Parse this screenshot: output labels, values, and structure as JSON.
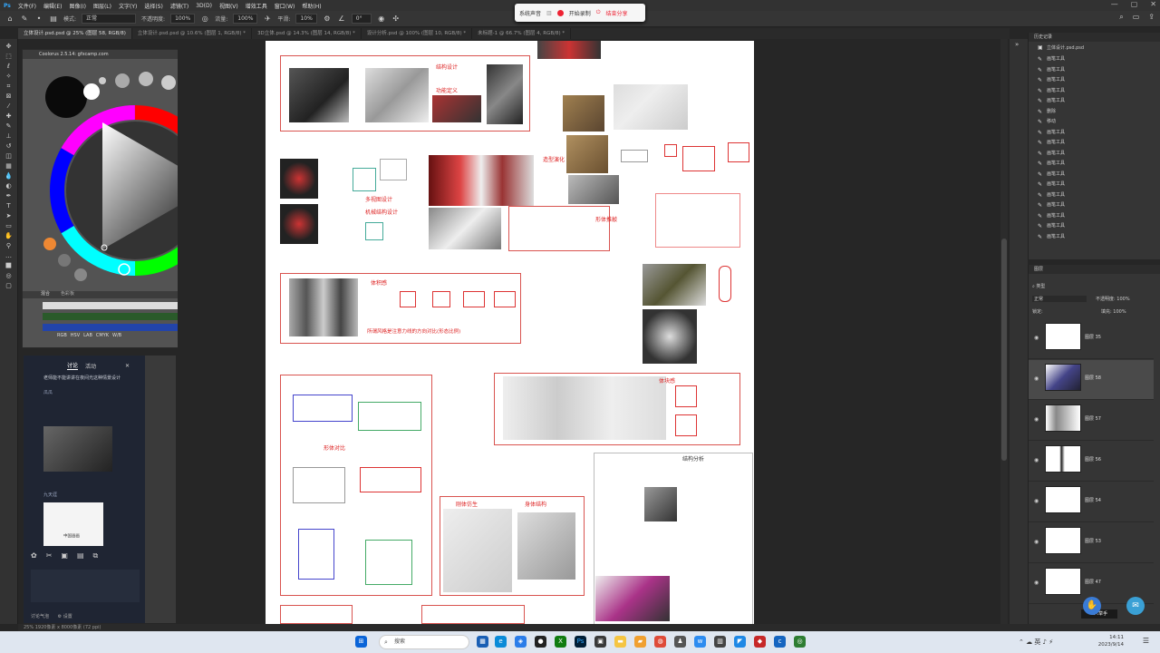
{
  "menubar": {
    "items": [
      "文件(F)",
      "编辑(E)",
      "图像(I)",
      "图层(L)",
      "文字(Y)",
      "选择(S)",
      "滤镜(T)",
      "3D(D)",
      "视图(V)",
      "增效工具",
      "窗口(W)",
      "帮助(H)"
    ]
  },
  "window_controls": {
    "minimize": "—",
    "maximize": "▢",
    "close": "✕"
  },
  "options": {
    "mode_label": "模式:",
    "mode_value": "正常",
    "opacity_label": "不透明度:",
    "opacity_value": "100%",
    "flow_label": "流量:",
    "flow_value": "100%",
    "smooth_label": "平滑:",
    "smooth_value": "10%",
    "angle_value": "0°"
  },
  "recorder": {
    "system_sound": "系统声音",
    "start": "开始录制",
    "end_share": "结束分享"
  },
  "tabs": [
    {
      "label": "立体设计.psd.psd @ 25% (图层 58, RGB/8)",
      "active": true
    },
    {
      "label": "立体设计.psd.psd @ 10.6% (图层 1, RGB/8) *",
      "active": false
    },
    {
      "label": "3D立体.psd @ 14.3% (图层 14, RGB/8) *",
      "active": false
    },
    {
      "label": "设计分析.psd @ 100% (图层 10, RGB/8) *",
      "active": false
    },
    {
      "label": "未标题-1 @ 66.7% (图层 4, RGB/8) *",
      "active": false
    }
  ],
  "coolorus": {
    "title": "Coolorus 2.5.14: gfxcamp.com",
    "tab_mix": "混合",
    "tab_swatch": "色彩板",
    "slider_values": [
      "2",
      "2",
      "-2"
    ],
    "modes": [
      "RGB",
      "HSV",
      "LAB",
      "CMYK",
      "W/B"
    ],
    "counter": "#0000"
  },
  "chat": {
    "tab_discuss": "讨论",
    "tab_activity": "活动",
    "message_text": "老师能不能讲讲在夜间光这种情景设计",
    "user1": "瓜瓜",
    "user2": "九天涯",
    "user2_image_caption": "中国画画",
    "bottom_text": "讨论气泡",
    "bottom_settings": "设置"
  },
  "page_notes": {
    "n1": "结构设计",
    "n2": "功能定义",
    "n3": "造型演化",
    "n4": "多视图设计",
    "n5": "机械结构设计",
    "n6": "形体推敲",
    "n7": "所谓风格是注意力线的方向对比(形态比例)",
    "n8": "体积感",
    "n9": "形体对比",
    "n10": "体块感",
    "n11": "结构分析",
    "n12": "刚体仿生",
    "n13": "身体结构"
  },
  "history": {
    "title": "历史记录",
    "doc_name": "立体设计.psd.psd",
    "items": [
      "画笔工具",
      "画笔工具",
      "画笔工具",
      "画笔工具",
      "画笔工具",
      "删除",
      "移动",
      "画笔工具",
      "画笔工具",
      "画笔工具",
      "画笔工具",
      "画笔工具",
      "画笔工具",
      "画笔工具",
      "画笔工具",
      "画笔工具",
      "画笔工具",
      "画笔工具"
    ]
  },
  "layers": {
    "title": "图层",
    "kind_label": "类型",
    "blend_value": "正常",
    "opacity_label": "不透明度:",
    "opacity_value": "100%",
    "lock_label": "锁定:",
    "fill_label": "填充:",
    "fill_value": "100%",
    "items": [
      "图层 35",
      "图层 58",
      "图层 57",
      "图层 56",
      "图层 54",
      "图层 53",
      "图层 47"
    ]
  },
  "status": {
    "text": "25% 1920像素 x 8000像素 (72 ppi)"
  },
  "taskbar": {
    "search_placeholder": "搜索",
    "time": "14:11",
    "date": "2023/9/14",
    "users_badge": "2人举手"
  }
}
